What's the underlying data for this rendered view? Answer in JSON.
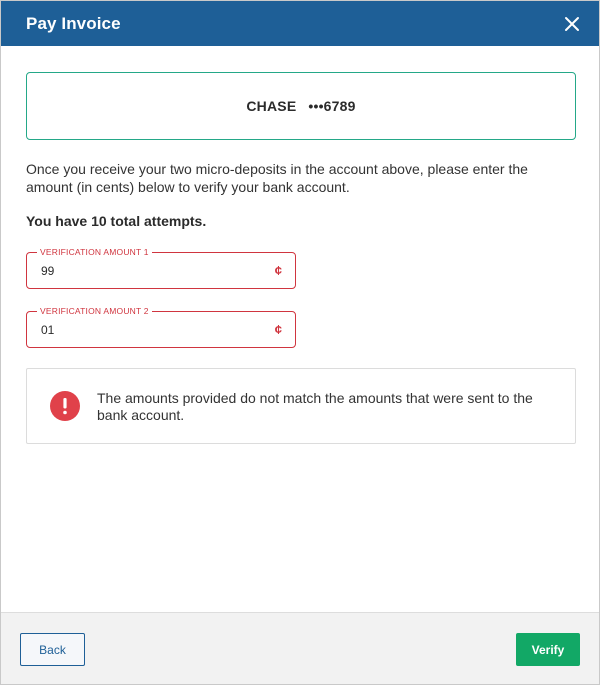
{
  "header": {
    "title": "Pay Invoice"
  },
  "bank": {
    "name": "CHASE",
    "masked_number": "•••6789"
  },
  "instructions": "Once you receive your two micro-deposits in the account above, please enter the amount (in cents) below to verify your bank account.",
  "attempts_text": "You have 10 total attempts.",
  "fields": [
    {
      "label": "VERIFICATION AMOUNT 1",
      "value": "99",
      "unit": "¢"
    },
    {
      "label": "VERIFICATION AMOUNT 2",
      "value": "01",
      "unit": "¢"
    }
  ],
  "error": {
    "message": "The amounts provided do not match the amounts that were sent to the bank account."
  },
  "footer": {
    "back_label": "Back",
    "verify_label": "Verify"
  },
  "colors": {
    "header_bg": "#1e5f97",
    "accent_green": "#12a866",
    "bank_border": "#24a888",
    "error_red": "#d0353f",
    "icon_error": "#e0414a"
  },
  "icons": {
    "close": "close-icon",
    "error": "error-icon"
  }
}
